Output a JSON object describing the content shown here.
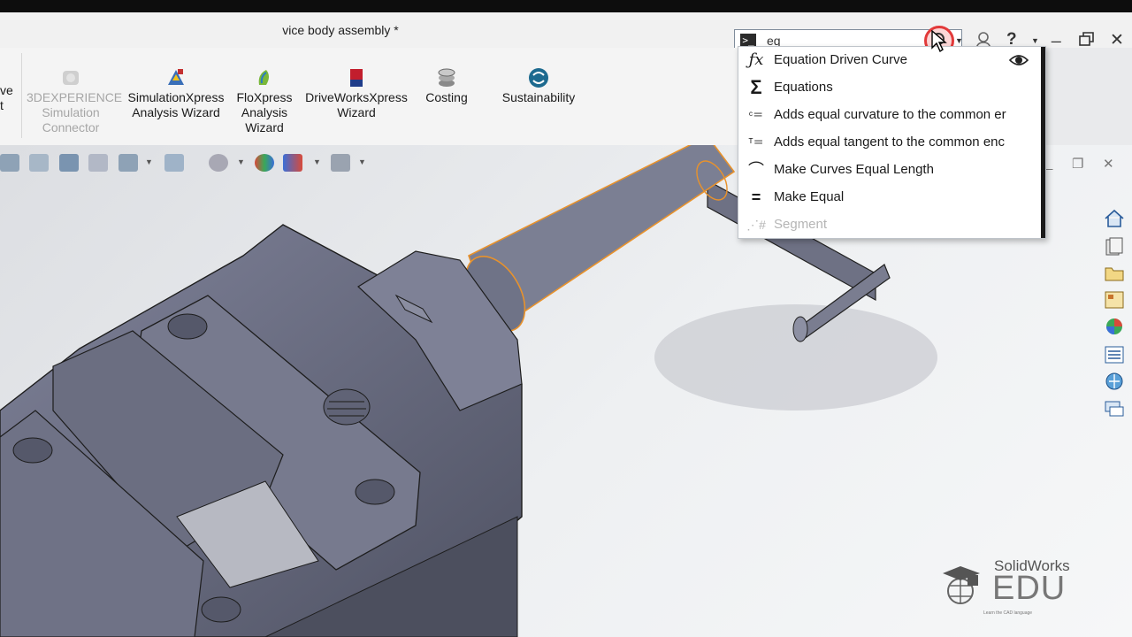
{
  "window": {
    "title": "vice body assembly *"
  },
  "search": {
    "query": "eq",
    "command_icon": ">_"
  },
  "title_icons": [
    "magnifier-icon",
    "user-icon",
    "help-icon",
    "minimize-icon",
    "restore-icon",
    "close-icon"
  ],
  "ribbon": {
    "cut_left_label_1": "ve",
    "cut_left_label_2": "t",
    "buttons": [
      {
        "label": "3DEXPERIENCE\nSimulation\nConnector",
        "disabled": true
      },
      {
        "label": "SimulationXpress\nAnalysis Wizard",
        "disabled": false
      },
      {
        "label": "FloXpress\nAnalysis\nWizard",
        "disabled": false
      },
      {
        "label": "DriveWorksXpress\nWizard",
        "disabled": false
      },
      {
        "label": "Costing",
        "disabled": false
      },
      {
        "label": "Sustainability",
        "disabled": false
      }
    ]
  },
  "dropdown": {
    "items": [
      {
        "label": "Equation Driven Curve",
        "icon": "equation-curve-icon",
        "disabled": false
      },
      {
        "label": "Equations",
        "icon": "sigma-icon",
        "disabled": false
      },
      {
        "label": "Adds equal curvature to the common er",
        "icon": "equal-curvature-icon",
        "disabled": false
      },
      {
        "label": "Adds equal tangent to the common enc",
        "icon": "equal-tangent-icon",
        "disabled": false
      },
      {
        "label": "Make Curves Equal Length",
        "icon": "equal-length-icon",
        "disabled": false
      },
      {
        "label": "Make Equal",
        "icon": "equal-icon",
        "disabled": false
      },
      {
        "label": "Segment",
        "icon": "segment-icon",
        "disabled": true
      }
    ]
  },
  "watermark": {
    "brand": "SolidWorks",
    "edu": "EDU",
    "tagline": "Learn the CAD language"
  },
  "colors": {
    "accent_highlight": "#e8922c",
    "model_body": "#6f7387",
    "search_circle": "#e23a3a"
  }
}
